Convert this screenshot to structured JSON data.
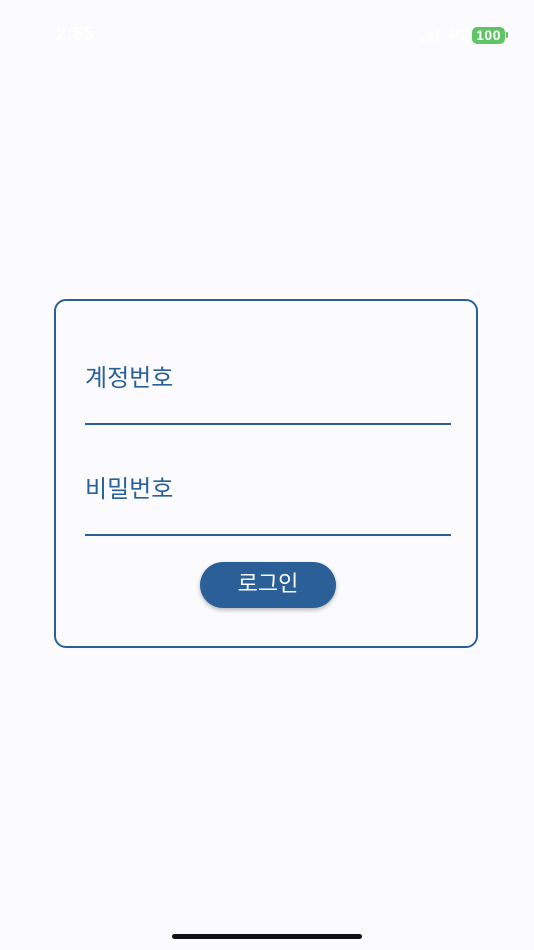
{
  "status_bar": {
    "time": "2:55",
    "network": "4G",
    "battery_level": "100",
    "battery_color": "#5fc465",
    "signal_bars": 4
  },
  "login_form": {
    "account_label": "계정번호",
    "account_value": "",
    "password_label": "비밀번호",
    "password_value": "",
    "login_button_label": "로그인"
  },
  "theme": {
    "accent": "#2a5f98",
    "background": "#fbfbfd"
  }
}
